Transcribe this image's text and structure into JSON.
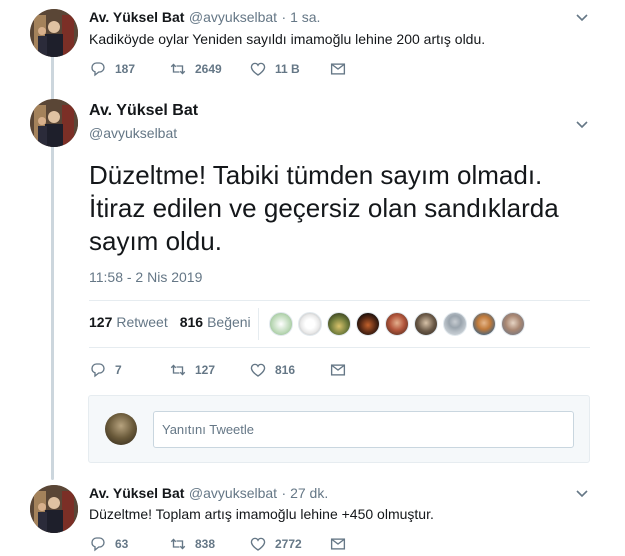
{
  "colors": {
    "text": "#14171a",
    "muted": "#657786",
    "divider": "#e6ecf0",
    "thread_line": "#ccd6dd"
  },
  "tweet1": {
    "name": "Av. Yüksel Bat",
    "handle": "@avyukselbat",
    "time": "· 1 sa.",
    "text": "Kadiköyde oylar Yeniden sayıldı imamoğlu lehine 200 artış oldu.",
    "replies": "187",
    "retweets": "2649",
    "likes": "11 B"
  },
  "main_tweet": {
    "name": "Av. Yüksel Bat",
    "handle": "@avyukselbat",
    "text": "Düzeltme! Tabiki tümden sayım olmadı. İtiraz edilen ve geçersiz olan sandıklarda sayım oldu.",
    "timestamp": "11:58 - 2 Nis 2019",
    "retweet_count": "127",
    "retweet_label": "Retweet",
    "like_count": "816",
    "like_label": "Beğeni",
    "replies": "7",
    "retweets": "127",
    "likes": "816"
  },
  "reply_box": {
    "placeholder": "Yanıtını Tweetle"
  },
  "tweet3": {
    "name": "Av. Yüksel Bat",
    "handle": "@avyukselbat",
    "time": "· 27 dk.",
    "text": "Düzeltme! Toplam artış imamoğlu lehine +450 olmuştur.",
    "replies": "63",
    "retweets": "838",
    "likes": "2772"
  },
  "icons": {
    "reply": "reply-icon",
    "retweet": "retweet-icon",
    "like": "heart-icon",
    "dm": "envelope-icon",
    "more": "chevron-down-icon"
  }
}
